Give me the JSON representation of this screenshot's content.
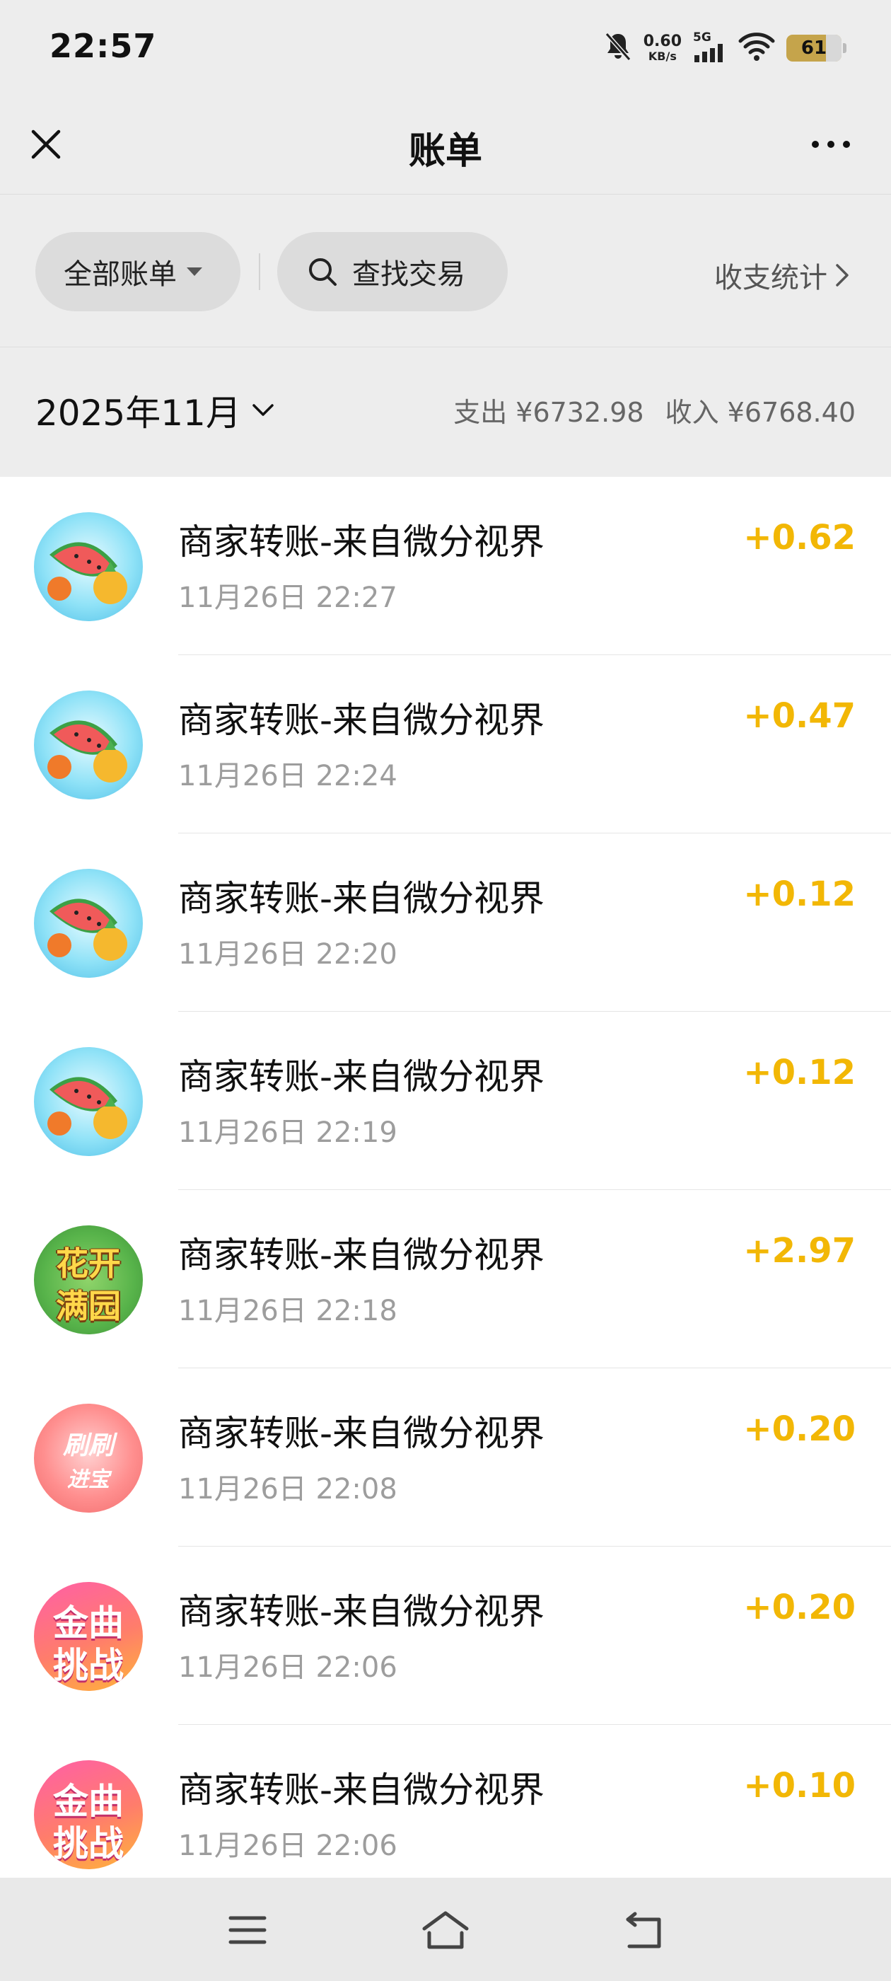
{
  "status_bar": {
    "time": "22:57",
    "net_speed_value": "0.60",
    "net_speed_unit": "KB/s",
    "signal_label": "5G",
    "battery_level": "61",
    "icons": [
      "bell-muted-icon",
      "signal-bars-icon",
      "wifi-icon",
      "battery-icon"
    ]
  },
  "header": {
    "title": "账单",
    "close_icon": "close-icon",
    "more_icon": "more-dots-icon"
  },
  "filters": {
    "all_bills_label": "全部账单",
    "search_label": "查找交易",
    "stats_label": "收支统计"
  },
  "month": {
    "label": "2025年11月",
    "expense": "支出 ¥6732.98",
    "income": "收入 ¥6768.40"
  },
  "transactions": [
    {
      "avatar": "watermelon-pineapple-icon",
      "title": "商家转账-来自微分视界",
      "time": "11月26日 22:27",
      "amount": "+0.62"
    },
    {
      "avatar": "watermelon-pineapple-icon",
      "title": "商家转账-来自微分视界",
      "time": "11月26日 22:24",
      "amount": "+0.47"
    },
    {
      "avatar": "watermelon-pineapple-icon",
      "title": "商家转账-来自微分视界",
      "time": "11月26日 22:20",
      "amount": "+0.12"
    },
    {
      "avatar": "watermelon-pineapple-icon",
      "title": "商家转账-来自微分视界",
      "time": "11月26日 22:19",
      "amount": "+0.12"
    },
    {
      "avatar": "huakai-manyuan-logo",
      "avatar_text_1": "花开",
      "avatar_text_2": "满园",
      "title": "商家转账-来自微分视界",
      "time": "11月26日 22:18",
      "amount": "+2.97"
    },
    {
      "avatar": "shuashua-jinbao-logo",
      "avatar_text_1": "刷刷",
      "avatar_text_2": "进宝",
      "title": "商家转账-来自微分视界",
      "time": "11月26日 22:08",
      "amount": "+0.20"
    },
    {
      "avatar": "jinqu-tiaozhan-logo",
      "avatar_text_1": "金曲",
      "avatar_text_2": "挑战",
      "title": "商家转账-来自微分视界",
      "time": "11月26日 22:06",
      "amount": "+0.20"
    },
    {
      "avatar": "jinqu-tiaozhan-logo",
      "avatar_text_1": "金曲",
      "avatar_text_2": "挑战",
      "title": "商家转账-来自微分视界",
      "time": "11月26日 22:06",
      "amount": "+0.10"
    }
  ],
  "nav": {
    "icons": [
      "menu-icon",
      "home-icon",
      "back-icon"
    ]
  },
  "colors": {
    "background": "#ededed",
    "list_background": "#ffffff",
    "income_amount": "#f2b705",
    "secondary_text": "#9d9d9d"
  }
}
